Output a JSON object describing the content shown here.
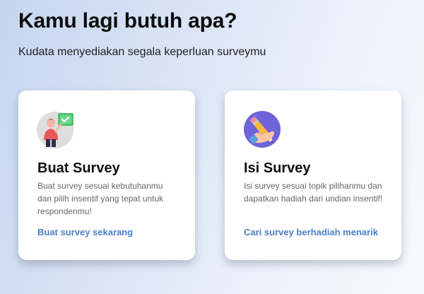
{
  "header": {
    "title": "Kamu lagi butuh apa?",
    "subtitle": "Kudata menyediakan segala keperluan surveymu"
  },
  "cards": [
    {
      "icon": "person-checklist-icon",
      "title": "Buat Survey",
      "description": "Buat survey sesuai kebutuhanmu dan pilih insentif yang tepat untuk respondenmu!",
      "link_label": "Buat survey sekarang"
    },
    {
      "icon": "hand-pencil-icon",
      "title": "Isi Survey",
      "description": "Isi survey sesuai topik pilihanmu dan dapatkan hadiah dari undian insentif!",
      "link_label": "Cari survey berhadiah menarik"
    }
  ],
  "colors": {
    "link": "#4a7fc8",
    "card_background": "#ffffff",
    "background_left": "#c6d5f0",
    "background_right": "#f7f9fd"
  }
}
